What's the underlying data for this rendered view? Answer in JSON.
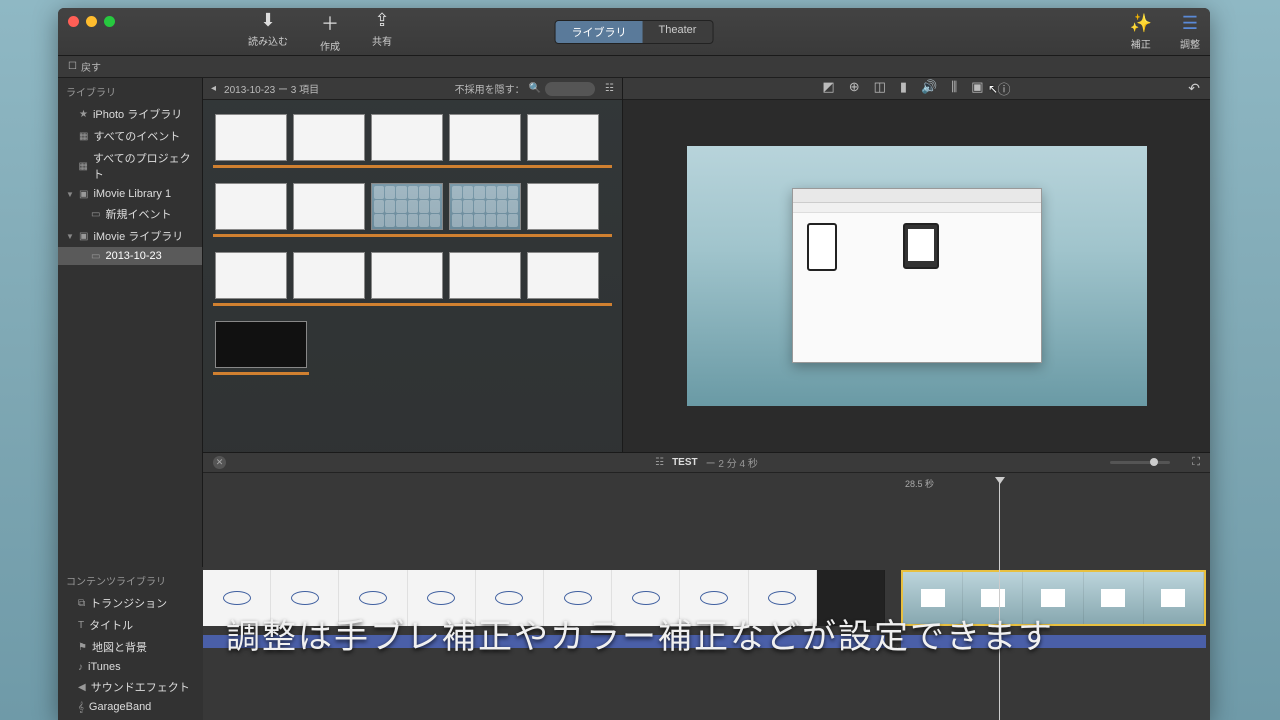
{
  "titlebar": {
    "back_label": "戻す",
    "import_label": "読み込む",
    "create_label": "作成",
    "share_label": "共有",
    "tab_library": "ライブラリ",
    "tab_theater": "Theater",
    "correct_label": "補正",
    "adjust_label": "調整"
  },
  "sidebar": {
    "header": "ライブラリ",
    "items": [
      {
        "label": "iPhoto ライブラリ",
        "glyph": "★"
      },
      {
        "label": "すべてのイベント",
        "glyph": "▦"
      },
      {
        "label": "すべてのプロジェクト",
        "glyph": "▦"
      },
      {
        "label": "iMovie Library 1",
        "glyph": "▣",
        "tri": "▼"
      },
      {
        "label": "新規イベント",
        "glyph": "▭",
        "lvl": 2
      },
      {
        "label": "iMovie ライブラリ",
        "glyph": "▣",
        "tri": "▼"
      },
      {
        "label": "2013-10-23",
        "glyph": "▭",
        "lvl": 2,
        "selected": true
      }
    ]
  },
  "browser": {
    "title": "2013-10-23 ー 3 項目",
    "hide_label": "不採用を隠す："
  },
  "timeline": {
    "project_name": "TEST",
    "duration": "ー 2 分 4 秒",
    "playhead_time": "28.5 秒"
  },
  "content_lib": {
    "header": "コンテンツライブラリ",
    "items": [
      {
        "label": "トランジション",
        "glyph": "⧉"
      },
      {
        "label": "タイトル",
        "glyph": "T"
      },
      {
        "label": "地図と背景",
        "glyph": "⚑"
      },
      {
        "label": "iTunes",
        "glyph": "♪"
      },
      {
        "label": "サウンドエフェクト",
        "glyph": "◀"
      },
      {
        "label": "GarageBand",
        "glyph": "𝄞"
      }
    ]
  },
  "subtitle": "調整は手ブレ補正やカラー補正などが設定できます"
}
